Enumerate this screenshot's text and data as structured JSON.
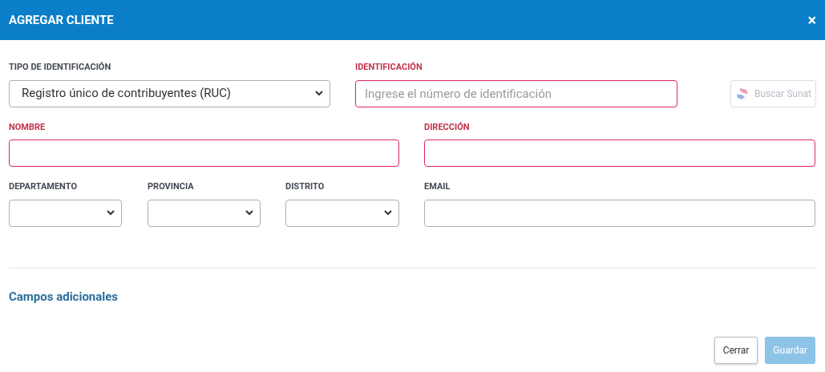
{
  "dialog": {
    "title": "AGREGAR CLIENTE",
    "close": "×"
  },
  "rows": [
    [
      {
        "kind": "select",
        "label": "TIPO DE IDENTIFICACIÓN",
        "value": "Registro único de contribuyentes (RUC)",
        "invalid": false
      },
      {
        "kind": "input",
        "label": "IDENTIFICACIÓN",
        "placeholder": "Ingrese el número de identificación",
        "invalid": true
      },
      {
        "kind": "button",
        "label": "Buscar Sunat",
        "disabled": true
      }
    ],
    [
      {
        "kind": "input",
        "label": "NOMBRE",
        "invalid": true
      },
      {
        "kind": "input",
        "label": "DIRECCIÓN",
        "invalid": true
      }
    ],
    [
      {
        "kind": "select",
        "label": "DEPARTAMENTO",
        "invalid": false
      },
      {
        "kind": "select",
        "label": "PROVINCIA",
        "invalid": false
      },
      {
        "kind": "select",
        "label": "DISTRITO",
        "invalid": false
      },
      {
        "kind": "input",
        "label": "EMAIL",
        "invalid": false
      }
    ]
  ],
  "extra_link": "Campos adicionales",
  "buttons": [
    {
      "label": "Cerrar",
      "kind": "secondary",
      "disabled": false
    },
    {
      "label": "Guardar",
      "kind": "primary",
      "disabled": true
    }
  ]
}
